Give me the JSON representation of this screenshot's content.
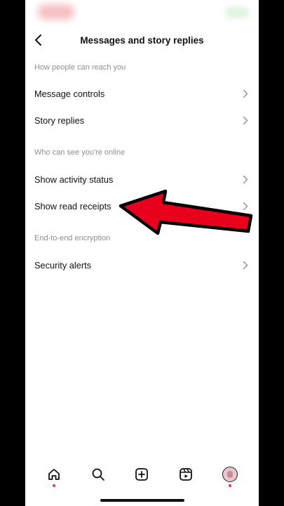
{
  "header": {
    "title": "Messages and story replies",
    "back_icon": "chevron-left-icon"
  },
  "sections": [
    {
      "label": "How people can reach you",
      "items": [
        {
          "label": "Message controls"
        },
        {
          "label": "Story replies"
        }
      ]
    },
    {
      "label": "Who can see you're online",
      "items": [
        {
          "label": "Show activity status"
        },
        {
          "label": "Show read receipts"
        }
      ]
    },
    {
      "label": "End-to-end encryption",
      "items": [
        {
          "label": "Security alerts"
        }
      ]
    }
  ],
  "annotation": {
    "arrow_color": "#e8001c",
    "arrow_target": "Show read receipts"
  },
  "bottom_nav": {
    "items": [
      "home-icon",
      "search-icon",
      "create-icon",
      "reels-icon",
      "profile-avatar"
    ],
    "notification_dot_color": "#ff3040"
  }
}
